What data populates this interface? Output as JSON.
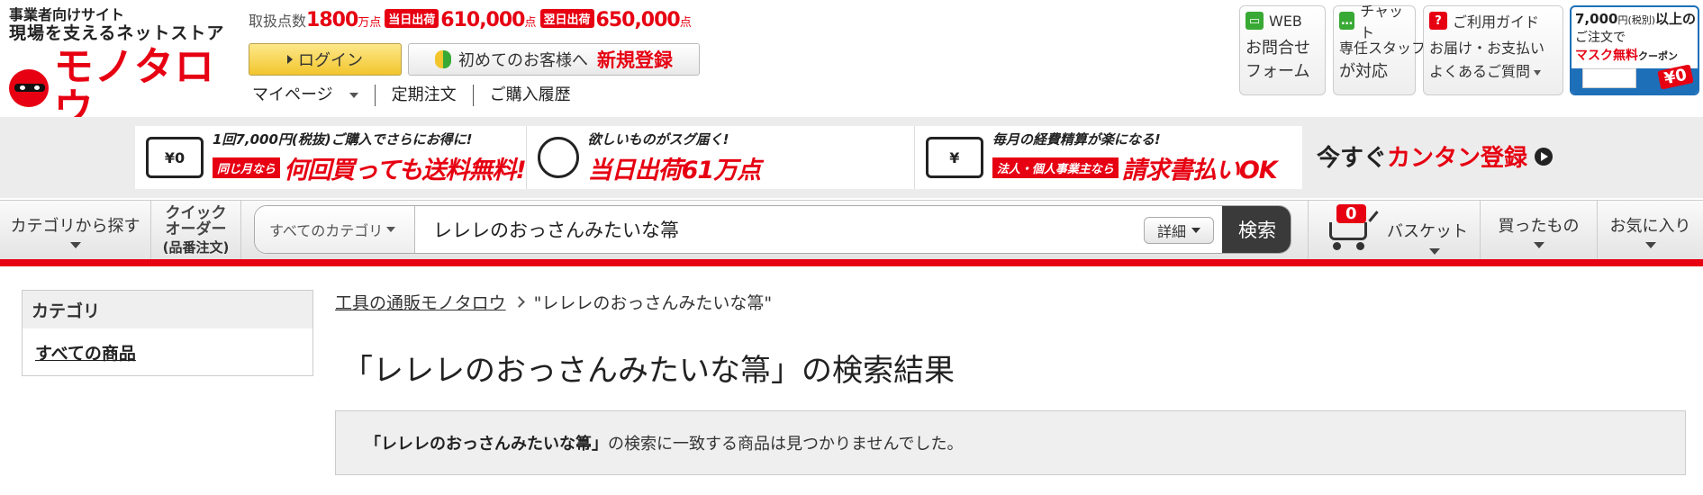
{
  "header": {
    "tagline1": "事業者向けサイト",
    "tagline2": "現場を支えるネットストア",
    "logo_text": "モノタロウ",
    "stats": {
      "items_label": "取扱点数",
      "items_value": "1800",
      "items_unit": "万点",
      "same_day_badge": "当日出荷",
      "same_day_value": "610,000",
      "same_day_unit": "点",
      "next_day_badge": "翌日出荷",
      "next_day_value": "650,000",
      "next_day_unit": "点"
    },
    "login_label": "ログイン",
    "register_prefix": "初めてのお客様へ",
    "register_label": "新規登録",
    "subnav": {
      "mypage": "マイページ",
      "subscription": "定期注文",
      "history": "ご購入履歴"
    },
    "help": {
      "web_title": "WEB",
      "web_line1": "お問合せ",
      "web_line2": "フォーム",
      "chat_title": "チャット",
      "chat_line1": "専任スタッフ",
      "chat_line2": "が対応",
      "guide_title": "ご利用ガイド",
      "guide_line1": "お届け・お支払い",
      "guide_line2": "よくあるご質問"
    },
    "coupon": {
      "line1_amount": "7,000",
      "line1_unit": "円(税別)",
      "line1_suffix": "以上の",
      "line2": "ご注文で",
      "line3_strong": "マスク無料",
      "line3_suffix": "クーポン",
      "tag": "¥0"
    }
  },
  "banner": {
    "items": [
      {
        "icon": "¥0",
        "top": "1回7,000円(税抜)ご購入でさらにお得に!",
        "pill": "同じ月なら",
        "big": "何回買っても送料無料!"
      },
      {
        "icon": "",
        "top": "欲しいものがスグ届く!",
        "pill": "",
        "big": "当日出荷61万点"
      },
      {
        "icon": "¥",
        "top": "毎月の経費精算が楽になる!",
        "pill": "法人・個人事業主なら",
        "big": "請求書払いOK"
      }
    ],
    "cta_prefix": "今すぐ",
    "cta_strong": "カンタン登録"
  },
  "nav": {
    "category": "カテゴリから探す",
    "quick_line1": "クイック",
    "quick_line2": "オーダー",
    "quick_sub": "(品番注文)",
    "search_category": "すべてのカテゴリ",
    "search_value": "レレレのおっさんみたいな箒",
    "detail": "詳細",
    "search_button": "検索",
    "basket_count": "0",
    "basket": "バスケット",
    "bought": "買ったもの",
    "favorites": "お気に入り"
  },
  "sidebar": {
    "heading": "カテゴリ",
    "all_products": "すべての商品"
  },
  "breadcrumb": {
    "home": "工具の通販モノタロウ",
    "current": "\"レレレのおっさんみたいな箒\""
  },
  "results": {
    "title": "「レレレのおっさんみたいな箒」の検索結果",
    "notice_query": "「レレレのおっさんみたいな箒」",
    "notice_text": "の検索に一致する商品は見つかりませんでした。"
  }
}
